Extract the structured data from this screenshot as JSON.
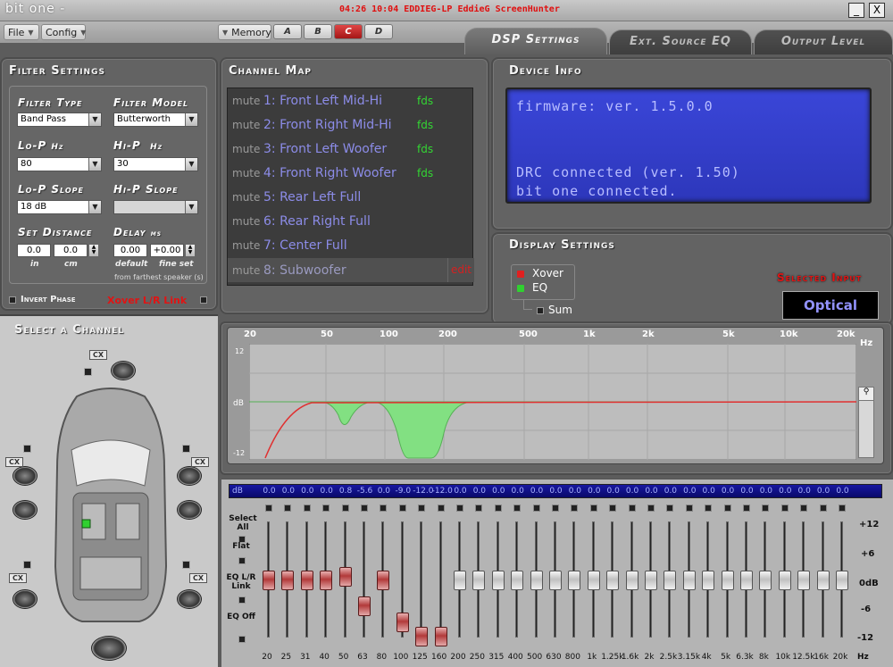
{
  "app_title": "bit one -",
  "capture_info": "04:26  10:04 EDDIEG-LP EddieG ScreenHunter",
  "window_buttons": {
    "minimize": "_",
    "close": "X"
  },
  "menu": {
    "file": "File",
    "config": "Config"
  },
  "memory": {
    "label": "Memory",
    "tabs": [
      "A",
      "B",
      "C",
      "D"
    ],
    "active": "C"
  },
  "tabs": [
    "DSP Settings",
    "Ext. Source EQ",
    "Output Level"
  ],
  "active_tab": "DSP Settings",
  "filter": {
    "title": "Filter Settings",
    "type_label": "Filter Type",
    "type_value": "Band Pass",
    "model_label": "Filter Model",
    "model_value": "Butterworth",
    "lop_label": "Lo-P",
    "lop_unit": "Hz",
    "lop_value": "80",
    "hip_label": "Hi-P",
    "hip_unit": "Hz",
    "hip_value": "30",
    "lop_slope_label": "Lo-P Slope",
    "lop_slope_value": "18 dB",
    "hip_slope_label": "Hi-P Slope",
    "hip_slope_value": "",
    "distance_label": "Set Distance",
    "distance_in": "0.0",
    "distance_cm": "0.0",
    "in_label": "in",
    "cm_label": "cm",
    "delay_label": "Delay",
    "delay_unit": "ms",
    "delay_default": "0.00",
    "delay_fine": "+0.00",
    "default_label": "default",
    "fine_label": "fine set",
    "farthest_note": "from farthest speaker (s)",
    "invert_phase": "Invert Phase",
    "xover_link": "Xover L/R Link"
  },
  "channel_map": {
    "title": "Channel Map",
    "mute_label": "mute",
    "edit_label": "edit",
    "channels": [
      {
        "name": "1: Front Left Mid-Hi",
        "tag": "fds"
      },
      {
        "name": "2: Front Right Mid-Hi",
        "tag": "fds"
      },
      {
        "name": "3: Front Left Woofer",
        "tag": "fds"
      },
      {
        "name": "4: Front Right Woofer",
        "tag": "fds"
      },
      {
        "name": "5: Rear Left Full",
        "tag": ""
      },
      {
        "name": "6: Rear Right Full",
        "tag": ""
      },
      {
        "name": "7: Center Full",
        "tag": ""
      },
      {
        "name": "8: Subwoofer",
        "tag": ""
      }
    ],
    "selected_index": 7
  },
  "device_info": {
    "title": "Device Info",
    "line1": "firmware: ver. 1.5.0.0",
    "line2": "DRC connected (ver. 1.50)",
    "line3": "bit one connected."
  },
  "display_settings": {
    "title": "Display Settings",
    "xover": "Xover",
    "eq": "EQ",
    "sum": "Sum",
    "selected_input_label": "Selected Input",
    "selected_input": "Optical"
  },
  "select_channel": {
    "title": "Select a Channel",
    "cx": "CX"
  },
  "graph": {
    "freq_labels": [
      "20",
      "50",
      "100",
      "200",
      "500",
      "1k",
      "2k",
      "5k",
      "10k",
      "20k"
    ],
    "unit": "Hz",
    "y_top": "12",
    "y_mid": "dB",
    "y_bot": "-12"
  },
  "eq": {
    "db_label": "dB",
    "bands": [
      "20",
      "25",
      "31",
      "40",
      "50",
      "63",
      "80",
      "100",
      "125",
      "160",
      "200",
      "250",
      "315",
      "400",
      "500",
      "630",
      "800",
      "1k",
      "1.25k",
      "1.6k",
      "2k",
      "2.5k",
      "3.15k",
      "4k",
      "5k",
      "6.3k",
      "8k",
      "10k",
      "12.5k",
      "16k",
      "20k"
    ],
    "gains": [
      0.0,
      0.0,
      0.0,
      0.0,
      0.8,
      -5.6,
      0.0,
      -9.0,
      -12.0,
      -12.0,
      0.0,
      0.0,
      0.0,
      0.0,
      0.0,
      0.0,
      0.0,
      0.0,
      0.0,
      0.0,
      0.0,
      0.0,
      0.0,
      0.0,
      0.0,
      0.0,
      0.0,
      0.0,
      0.0,
      0.0,
      0.0
    ],
    "gain_labels": [
      "0.0",
      "0.0",
      "0.0",
      "0.0",
      "0.8",
      "-5.6",
      "0.0",
      "-9.0",
      "-12.0",
      "-12.0",
      "0.0",
      "0.0",
      "0.0",
      "0.0",
      "0.0",
      "0.0",
      "0.0",
      "0.0",
      "0.0",
      "0.0",
      "0.0",
      "0.0",
      "0.0",
      "0.0",
      "0.0",
      "0.0",
      "0.0",
      "0.0",
      "0.0",
      "0.0",
      "0.0"
    ],
    "red_count": 10,
    "select_all": "Select All",
    "flat": "Flat",
    "lr_link": "EQ L/R Link",
    "eq_off": "EQ Off",
    "scale": [
      "+12",
      "+6",
      "0dB",
      "-6",
      "-12"
    ],
    "hz": "Hz"
  },
  "colors": {
    "accent_red": "#e01414",
    "lcd_blue": "#3440cc",
    "channel_text": "#8c8ce8",
    "fds_green": "#33d633"
  }
}
